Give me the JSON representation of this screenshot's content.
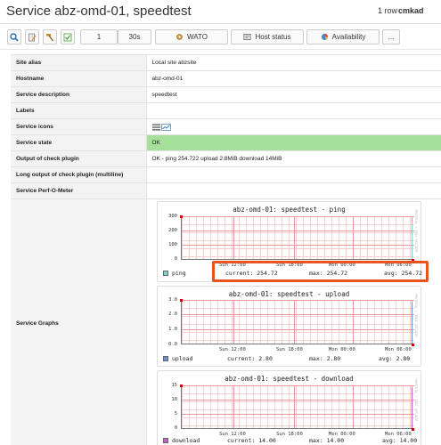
{
  "header": {
    "title": "Service abz-omd-01, speedtest",
    "rows_info": "1 row",
    "user": "cmkad"
  },
  "toolbar": {
    "refresh_count": "1",
    "refresh_interval": "30s",
    "wato_label": "WATO",
    "host_status_label": "Host status",
    "availability_label": "Availability",
    "more_label": "..."
  },
  "table": {
    "site_alias": {
      "key": "Site alias",
      "value": "Local site abzsite"
    },
    "hostname": {
      "key": "Hostname",
      "value": "abz-omd-01"
    },
    "service_description": {
      "key": "Service description",
      "value": "speedtest"
    },
    "labels": {
      "key": "Labels",
      "value": ""
    },
    "service_icons": {
      "key": "Service icons"
    },
    "service_state": {
      "key": "Service state",
      "value": "OK"
    },
    "output": {
      "key": "Output of check plugin",
      "value": "OK - ping 254.722 upload 2.8MiB download 14MiB"
    },
    "long_output": {
      "key": "Long output of check plugin (multiline)",
      "value": ""
    },
    "perf_o_meter": {
      "key": "Service Perf-O-Meter",
      "value": ""
    },
    "service_graphs": {
      "key": "Service Graphs"
    }
  },
  "graphs": {
    "ping": {
      "title": "abz-omd-01: speedtest - ping",
      "side_text": "PROTOCOL / TOBI OETIKER",
      "yticks": [
        "300",
        "200",
        "100",
        "0"
      ],
      "xticks": [
        "Sun 12:00",
        "Sun 18:00",
        "Mon 00:00",
        "Mon 06:00"
      ],
      "legend": {
        "name": "ping",
        "current": "current: 254.72",
        "max": "max: 254.72",
        "avg": "avg: 254.72"
      },
      "color": "#7fd3d3"
    },
    "upload": {
      "title": "abz-omd-01: speedtest - upload",
      "side_text": "PROTOCOL / TOBI OETIKER",
      "yticks": [
        "3.0",
        "2.0",
        "1.0",
        "0.0"
      ],
      "xticks": [
        "Sun 12:00",
        "Sun 18:00",
        "Mon 00:00",
        "Mon 06:00"
      ],
      "legend": {
        "name": "upload",
        "current": "current:   2.80",
        "max": "max:   2.80",
        "avg": "avg:   2.80"
      },
      "color": "#6f8fc9"
    },
    "download": {
      "title": "abz-omd-01: speedtest - download",
      "side_text": "PROTOCOL / TOBI OETIKER",
      "yticks": [
        "15",
        "10",
        "5",
        "0"
      ],
      "xticks": [
        "Sun 12:00",
        "Sun 18:00",
        "Mon 00:00",
        "Mon 06:00"
      ],
      "legend": {
        "name": "download",
        "current": "current: 14.00",
        "max": "max: 14.00",
        "avg": "avg: 14.00"
      },
      "color": "#c25fc7"
    }
  },
  "colors": {
    "state_ok": "#a4e09a",
    "highlight": "#e8531e",
    "grid": "#e39a9a"
  }
}
